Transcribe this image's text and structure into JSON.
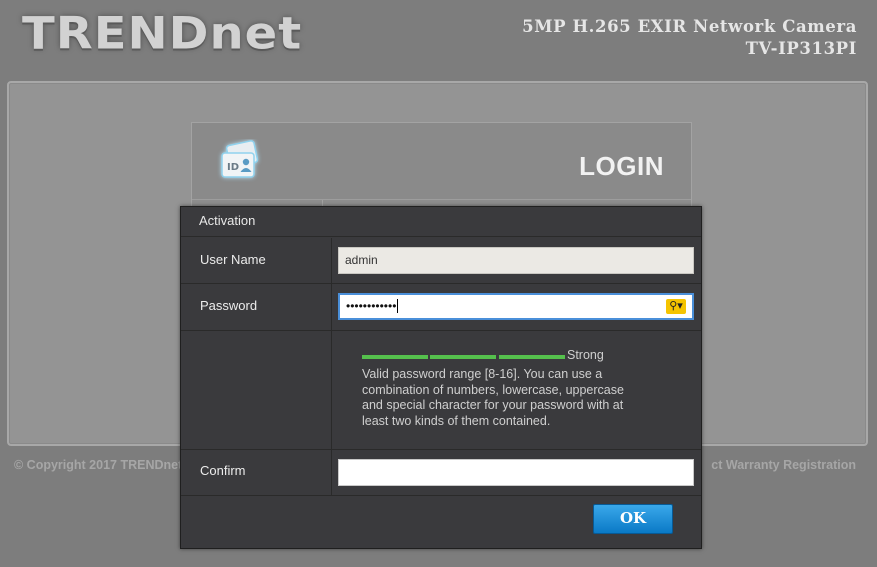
{
  "header": {
    "logo": "TRENDnet",
    "camera_name": "5MP H.265 EXIR Network Camera",
    "camera_model": "TV-IP313PI"
  },
  "login": {
    "title": "LOGIN",
    "icon": "id-card-icon"
  },
  "footer": {
    "copyright": "© Copyright 2017 TRENDnet.",
    "warranty": "ct Warranty Registration"
  },
  "dialog": {
    "title": "Activation",
    "username_label": "User Name",
    "username_value": "admin",
    "password_label": "Password",
    "password_value": "••••••••••••",
    "password_toggle_icon": "key-icon",
    "strength_label": "Strong",
    "strength_level": 3,
    "strength_max": 3,
    "hint": "Valid password range [8-16]. You can use a combination of numbers, lowercase, uppercase and special character for your password with at least two kinds of them contained.",
    "confirm_label": "Confirm",
    "confirm_value": "",
    "ok_label": "OK"
  },
  "colors": {
    "background": "#7d7d7d",
    "dialog_bg": "#3a3a3d",
    "strength_bar": "#55c04d",
    "focus_border": "#4a8fd9",
    "ok_button": "#0a79c6",
    "key_button": "#f5c400"
  }
}
